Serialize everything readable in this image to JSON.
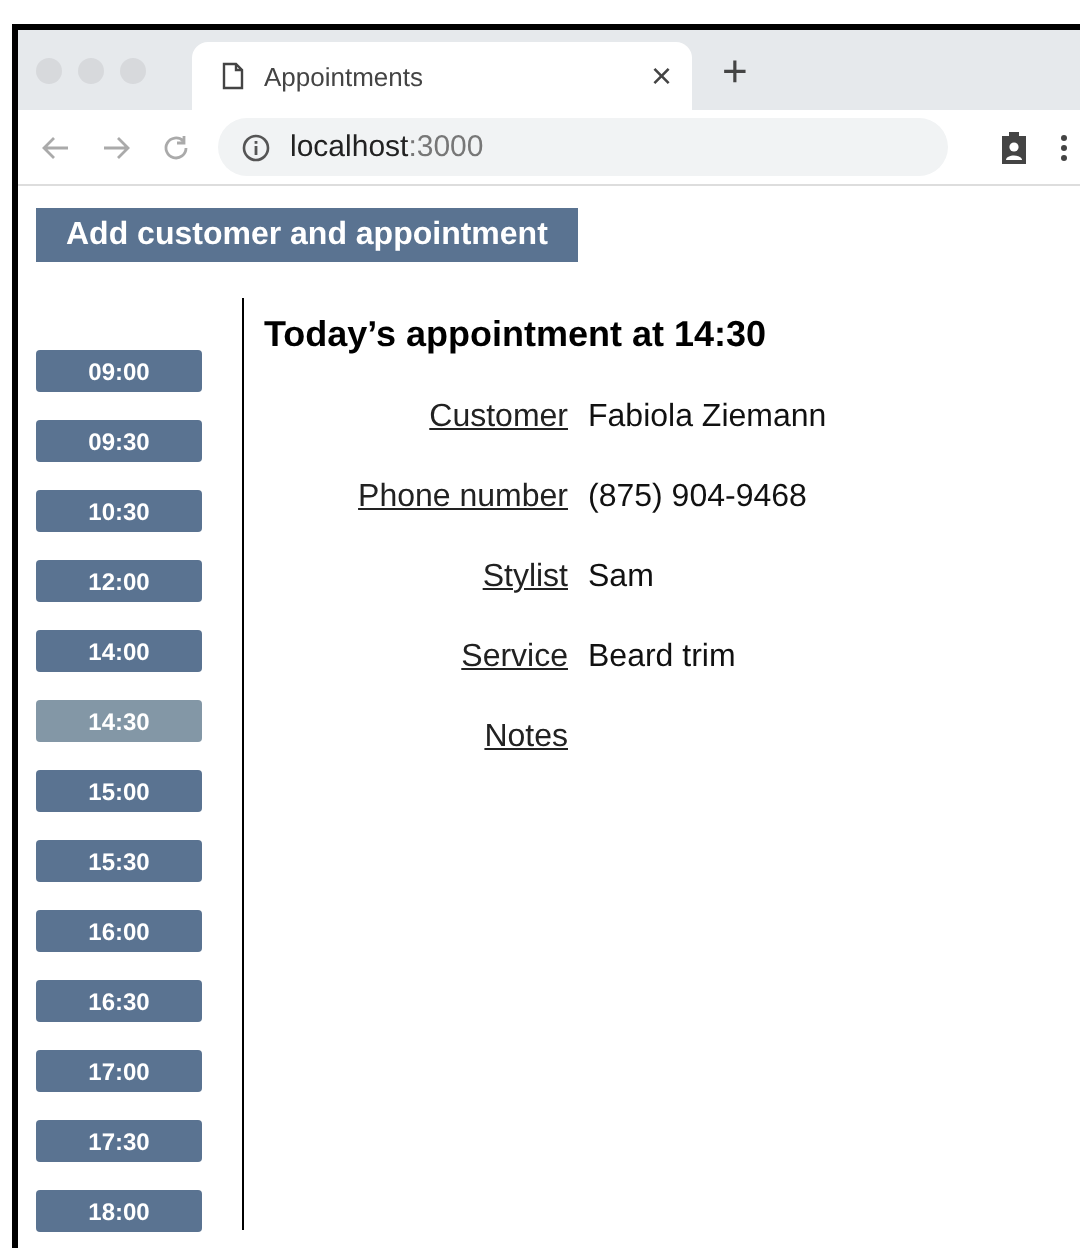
{
  "browser": {
    "tab_title": "Appointments",
    "close_glyph": "×",
    "new_tab_glyph": "+",
    "url_host": "localhost",
    "url_port": ":3000"
  },
  "add_button": "Add customer and appointment",
  "slots": [
    {
      "time": "09:00",
      "selected": false
    },
    {
      "time": "09:30",
      "selected": false
    },
    {
      "time": "10:30",
      "selected": false
    },
    {
      "time": "12:00",
      "selected": false
    },
    {
      "time": "14:00",
      "selected": false
    },
    {
      "time": "14:30",
      "selected": true
    },
    {
      "time": "15:00",
      "selected": false
    },
    {
      "time": "15:30",
      "selected": false
    },
    {
      "time": "16:00",
      "selected": false
    },
    {
      "time": "16:30",
      "selected": false
    },
    {
      "time": "17:00",
      "selected": false
    },
    {
      "time": "17:30",
      "selected": false
    },
    {
      "time": "18:00",
      "selected": false
    }
  ],
  "heading": "Today’s appointment at 14:30",
  "fields": [
    {
      "label": "Customer",
      "value": "Fabiola Ziemann"
    },
    {
      "label": "Phone number",
      "value": "(875) 904-9468"
    },
    {
      "label": "Stylist",
      "value": "Sam"
    },
    {
      "label": "Service",
      "value": "Beard trim"
    },
    {
      "label": "Notes"
    }
  ]
}
